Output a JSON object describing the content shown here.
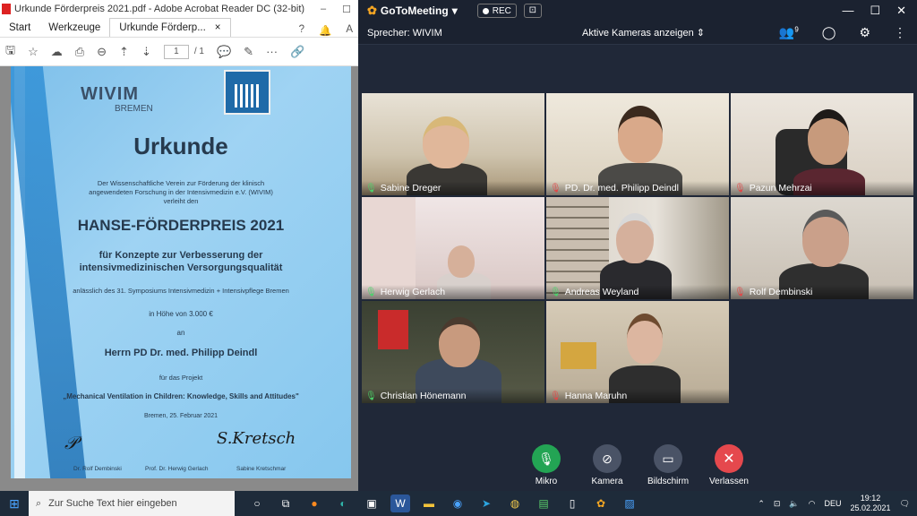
{
  "acrobat": {
    "title": "Urkunde Förderpreis 2021.pdf - Adobe Acrobat Reader DC (32-bit)",
    "tabs": [
      "Start",
      "Werkzeuge",
      "Urkunde Förderp..."
    ],
    "page_current": "1",
    "page_total": "/ 1",
    "cert": {
      "org": "WIVIM",
      "org_city": "BREMEN",
      "title": "Urkunde",
      "intro": "Der Wissenschaftliche Verein zur Förderung der klinisch angewendeten Forschung in der Intensivmedizin e.V. (WIVIM) verleiht den",
      "prize": "HANSE-FÖRDERPREIS 2021",
      "for_line1": "für Konzepte zur Verbesserung der",
      "for_line2": "intensivmedizinischen Versorgungsqualität",
      "occasion": "anlässlich des 31. Symposiums Intensivmedizin + Intensivpflege Bremen",
      "amount": "in Höhe von 3.000 €",
      "an": "an",
      "recipient": "Herrn PD Dr. med. Philipp Deindl",
      "project_intro": "für das Projekt",
      "project": "„Mechanical Ventilation in Children: Knowledge, Skills and Attitudes\"",
      "date": "Bremen, 25. Februar 2021",
      "sig1": "Dr. Rolf Dembinski",
      "sig2": "Prof. Dr. Herwig Gerlach",
      "sig3": "Sabine Kretschmar"
    }
  },
  "gtm": {
    "app_name": "GoToMeeting",
    "rec_label": "REC",
    "speaker": "Sprecher: WIVIM",
    "camera_mode": "Aktive Kameras anzeigen",
    "participant_count": "9",
    "participants": [
      {
        "name": "Sabine Dreger",
        "mic": "on"
      },
      {
        "name": "PD. Dr. med. Philipp Deindl",
        "mic": "off"
      },
      {
        "name": "Pazun Mehrzai",
        "mic": "off"
      },
      {
        "name": "Herwig Gerlach",
        "mic": "on"
      },
      {
        "name": "Andreas Weyland",
        "mic": "on"
      },
      {
        "name": "Rolf Dembinski",
        "mic": "off"
      },
      {
        "name": "Christian Hönemann",
        "mic": "on"
      },
      {
        "name": "Hanna Maruhn",
        "mic": "off"
      }
    ],
    "controls": {
      "mic": "Mikro",
      "camera": "Kamera",
      "screen": "Bildschirm",
      "leave": "Verlassen"
    }
  },
  "taskbar": {
    "search_placeholder": "Zur Suche Text hier eingeben",
    "lang": "DEU",
    "time": "19:12",
    "date": "25.02.2021"
  }
}
